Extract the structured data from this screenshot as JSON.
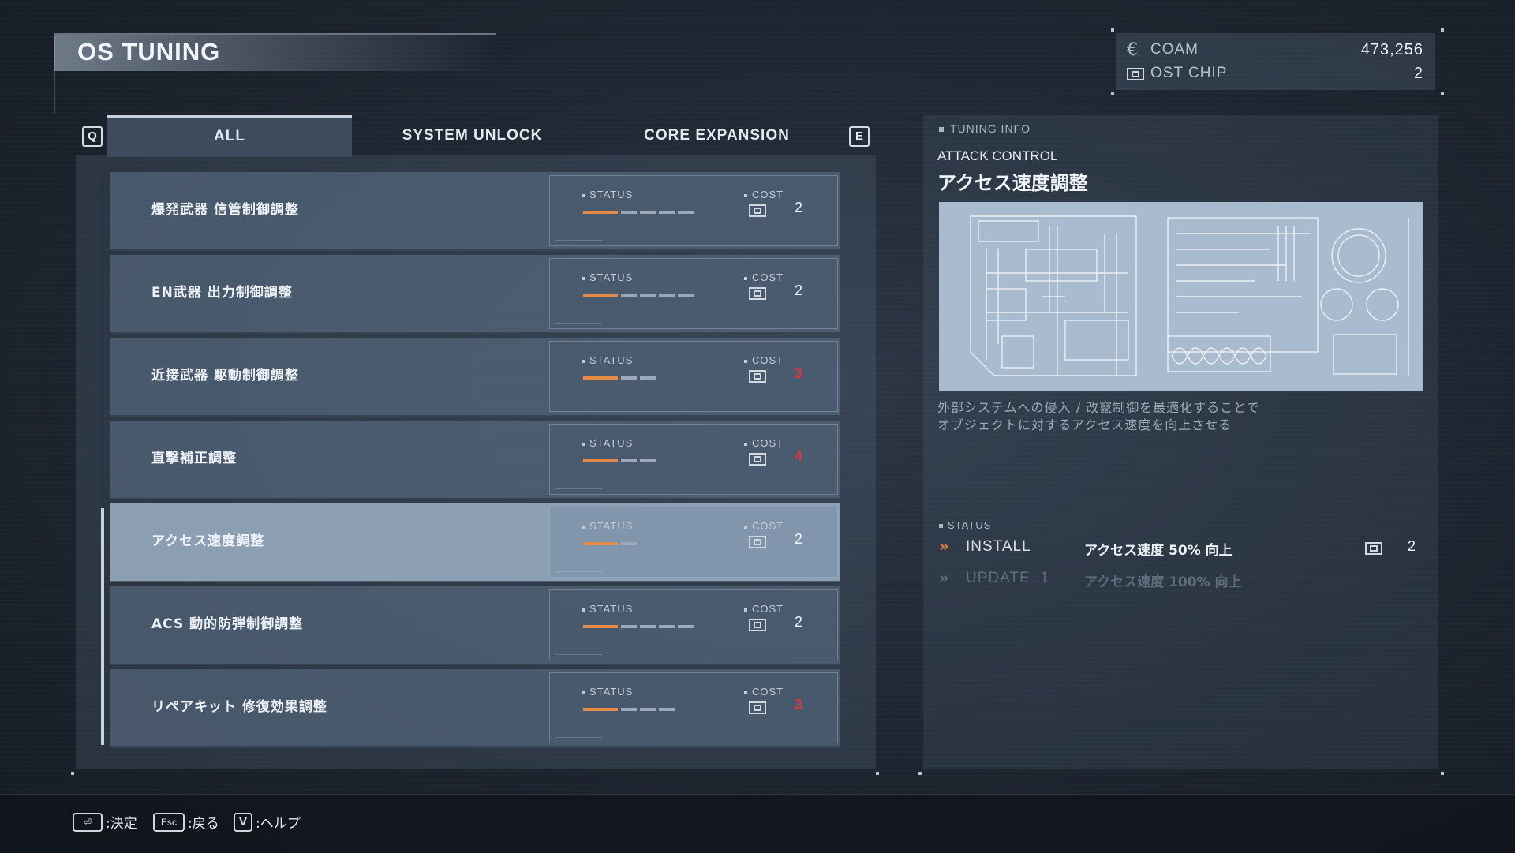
{
  "header": {
    "title": "OS TUNING"
  },
  "currency": [
    {
      "icon": "coam-currency-icon",
      "label": "COAM",
      "value": "473,256"
    },
    {
      "icon": "ost-chip-icon",
      "label": "OST CHIP",
      "value": "2"
    }
  ],
  "tabs": {
    "prev_key": "Q",
    "next_key": "E",
    "items": [
      {
        "label": "ALL",
        "active": true
      },
      {
        "label": "SYSTEM UNLOCK",
        "active": false
      },
      {
        "label": "CORE EXPANSION",
        "active": false
      }
    ]
  },
  "list_labels": {
    "status": "STATUS",
    "cost": "COST"
  },
  "tunings": [
    {
      "name": "爆発武器 信管制御調整",
      "level": 1,
      "max_level": 5,
      "cost": "2",
      "cost_insufficient": false,
      "selected": false
    },
    {
      "name": "EN武器 出力制御調整",
      "level": 1,
      "max_level": 5,
      "cost": "2",
      "cost_insufficient": false,
      "selected": false
    },
    {
      "name": "近接武器 駆動制御調整",
      "level": 1,
      "max_level": 3,
      "cost": "3",
      "cost_insufficient": true,
      "selected": false
    },
    {
      "name": "直撃補正調整",
      "level": 1,
      "max_level": 3,
      "cost": "4",
      "cost_insufficient": true,
      "selected": false
    },
    {
      "name": "アクセス速度調整",
      "level": 1,
      "max_level": 2,
      "cost": "2",
      "cost_insufficient": false,
      "selected": true
    },
    {
      "name": "ACS 動的防弾制御調整",
      "level": 1,
      "max_level": 5,
      "cost": "2",
      "cost_insufficient": false,
      "selected": false
    },
    {
      "name": "リペアキット 修復効果調整",
      "level": 1,
      "max_level": 4,
      "cost": "3",
      "cost_insufficient": true,
      "selected": false
    }
  ],
  "info": {
    "header": "TUNING INFO",
    "category": "ATTACK CONTROL",
    "name": "アクセス速度調整",
    "description_line1": "外部システムへの侵入 / 改竄制御を最適化することで",
    "description_line2": "オブジェクトに対するアクセス速度を向上させる",
    "status_header": "STATUS",
    "upgrades": [
      {
        "kind": "INSTALL",
        "effect": "アクセス速度 50% 向上",
        "cost": "2",
        "active": true
      },
      {
        "kind": "UPDATE .1",
        "effect": "アクセス速度 100% 向上",
        "cost": "",
        "active": false
      }
    ]
  },
  "footer": [
    {
      "key": "⏎",
      "label": ":決定"
    },
    {
      "key": "Esc",
      "label": ":戻る"
    },
    {
      "key": "V",
      "label": ":ヘルプ"
    }
  ],
  "colors": {
    "accent": "#e68a45",
    "insufficient": "#e0343a",
    "selected_row": "#9cb0c6"
  }
}
